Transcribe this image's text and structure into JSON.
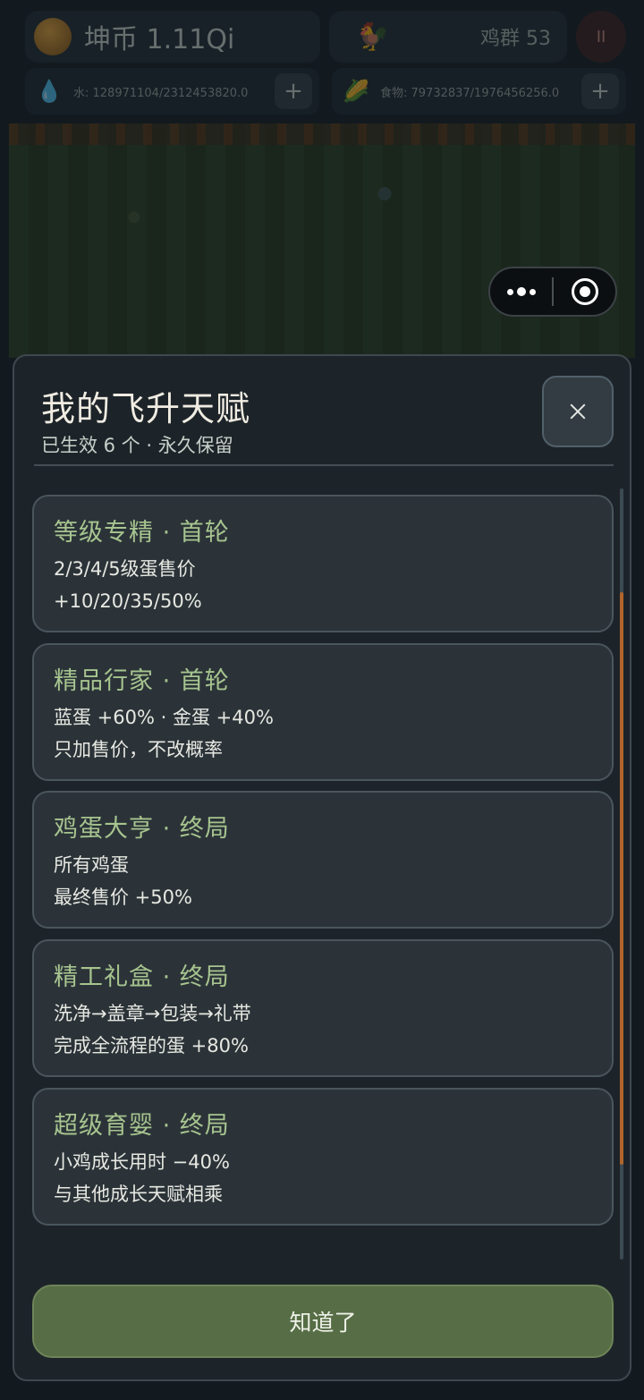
{
  "hud": {
    "coin_label": "坤币 1.11Qi",
    "flock_label": "鸡群 53",
    "pause_label": "II",
    "water_label": "水: 128971104/2312453820.0",
    "food_label": "食物: 79732837/1976456256.0",
    "plus_label": "+"
  },
  "modal": {
    "title": "我的飞升天赋",
    "subtitle": "已生效 6 个 · 永久保留",
    "confirm_label": "知道了"
  },
  "talents": [
    {
      "title": "等级专精 · 首轮",
      "line1": "2/3/4/5级蛋售价",
      "line2": "+10/20/35/50%"
    },
    {
      "title": "精品行家 · 首轮",
      "line1": "蓝蛋 +60% · 金蛋 +40%",
      "line2": "只加售价，不改概率"
    },
    {
      "title": "鸡蛋大亨 · 终局",
      "line1": "所有鸡蛋",
      "line2": "最终售价 +50%"
    },
    {
      "title": "精工礼盒 · 终局",
      "line1": "洗净→盖章→包装→礼带",
      "line2": "完成全流程的蛋 +80%"
    },
    {
      "title": "超级育婴 · 终局",
      "line1": "小鸡成长用时 −40%",
      "line2": "与其他成长天赋相乘"
    }
  ],
  "scroll_position": 0.19
}
